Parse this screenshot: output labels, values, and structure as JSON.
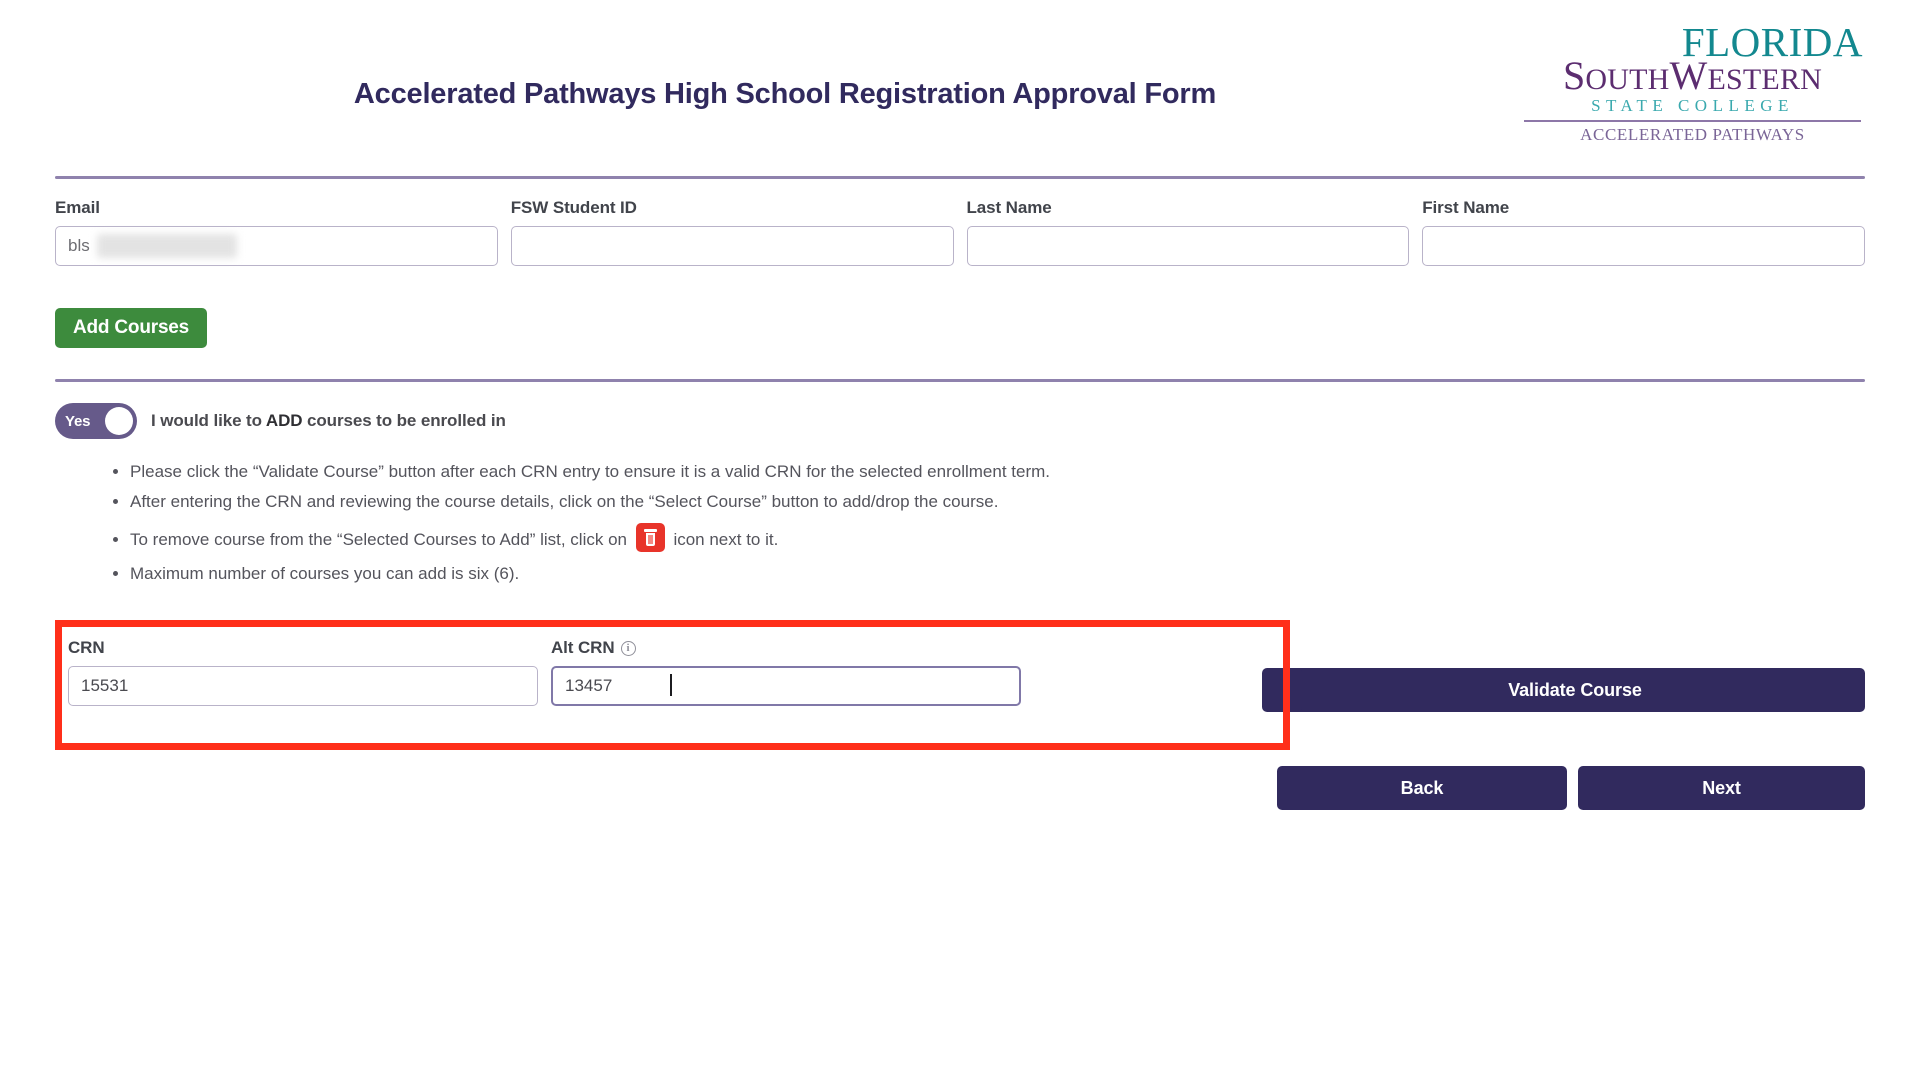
{
  "header": {
    "title": "Accelerated Pathways High School Registration Approval Form",
    "logo": {
      "line1": "FLORIDA",
      "line2_a": "S",
      "line2_b": "OUTH",
      "line2_c": "W",
      "line2_d": "ESTERN",
      "line3": "STATE COLLEGE",
      "line4": "ACCELERATED PATHWAYS"
    }
  },
  "student_fields": [
    {
      "label": "Email",
      "value": "bls",
      "placeholder": ""
    },
    {
      "label": "FSW Student ID",
      "value": "",
      "placeholder": ""
    },
    {
      "label": "Last Name",
      "value": "",
      "placeholder": ""
    },
    {
      "label": "First Name",
      "value": "",
      "placeholder": ""
    }
  ],
  "add_courses_button": "Add Courses",
  "toggle": {
    "state_label": "Yes",
    "description_prefix": "I would like to ",
    "description_strong": "ADD",
    "description_suffix": " courses to be enrolled in"
  },
  "instructions": [
    {
      "text": "Please click the “Validate Course” button after each CRN entry to ensure it is a valid CRN for the selected enrollment term."
    },
    {
      "text": "After entering the CRN and reviewing the course details, click on the “Select Course” button to add/drop the course."
    },
    {
      "text_before": "To remove course from the “Selected Courses to Add” list, click on ",
      "icon": "trash-icon",
      "text_after": " icon next to it."
    },
    {
      "text": "Maximum number of courses you can add is six (6)."
    }
  ],
  "crn_section": {
    "crn_label": "CRN",
    "crn_value": "15531",
    "alt_crn_label": "Alt CRN",
    "alt_crn_info_icon": "info-icon",
    "alt_crn_value": "13457",
    "validate_button": "Validate Course",
    "select_course_button": ""
  },
  "navigation": {
    "back_button": "Back",
    "next_button": "Next"
  },
  "colors": {
    "brand_purple": "#312a5e",
    "logo_teal": "#13888f",
    "logo_purple": "#5c2d70",
    "add_green": "#3d8b3d",
    "toggle_purple": "#665a8a",
    "annotation_red": "#ff2f1a",
    "trash_red": "#e8342a",
    "divider_purple": "#8f82ad"
  }
}
